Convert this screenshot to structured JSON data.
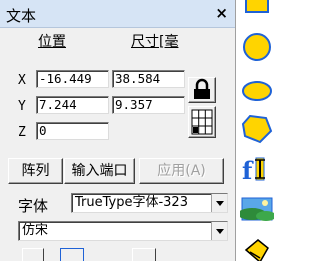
{
  "panel": {
    "title": "文本",
    "close_label": "×",
    "headers": {
      "position": "位置",
      "size": "尺寸[毫"
    },
    "rows": [
      {
        "axis": "X",
        "position": "-16.449",
        "size": "38.584"
      },
      {
        "axis": "Y",
        "position": "7.244",
        "size": "9.357"
      },
      {
        "axis": "Z",
        "position": "0"
      }
    ],
    "buttons": {
      "array": "阵列",
      "input_port": "输入端口",
      "apply": "应用(A)"
    },
    "font": {
      "label": "字体",
      "type_value": "TrueType字体-323",
      "face_value": "仿宋"
    }
  },
  "toolbar": {
    "tools": [
      "circle-tool-icon",
      "ellipse-tool-icon",
      "polygon-tool-icon",
      "text-tool-icon",
      "image-tool-icon",
      "clipart-tool-icon"
    ]
  },
  "colors": {
    "titlebar": "#d6e4f5",
    "panel_bg": "#f0f0f0",
    "tool_yellow": "#ffd400",
    "tool_blue": "#1f62d6"
  }
}
